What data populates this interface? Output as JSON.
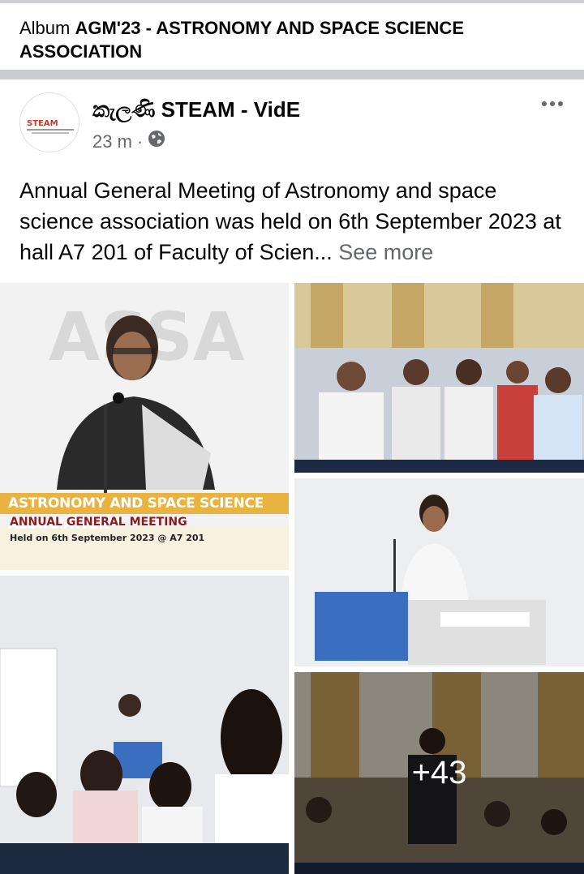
{
  "album": {
    "prefix": "Album",
    "name": "AGM'23 - ASTRONOMY AND SPACE SCIENCE ASSOCIATION"
  },
  "post": {
    "page_name": "කැලණි STEAM - VidE",
    "time": "23 m",
    "privacy_icon": "globe-icon",
    "text": "Annual General Meeting of Astronomy and space science association was held on 6th September 2023 at hall A7 201 of Faculty of Scien...",
    "see_more": "See more",
    "more_icon": "more-horizontal-icon"
  },
  "photos": {
    "poster": {
      "title": "ASTRONOMY AND SPACE SCIENCE ASSOCIATION",
      "subtitle": "ANNUAL GENERAL MEETING",
      "held": "Held on 6th September 2023 @ A7 201"
    },
    "remaining_count": "+43"
  },
  "colors": {
    "secondary_text": "#65676b",
    "separator": "#c9ccd1"
  }
}
